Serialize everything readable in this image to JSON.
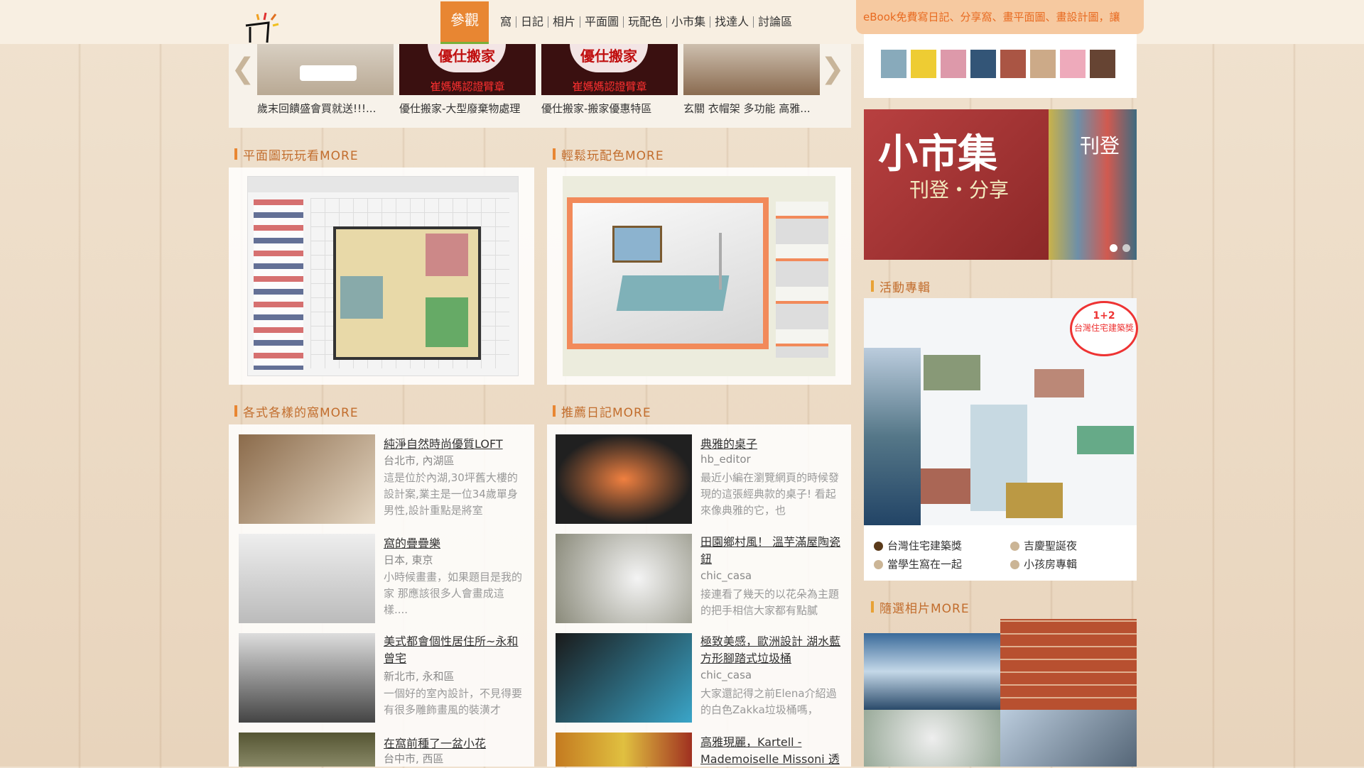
{
  "header": {
    "nav_active": "參觀",
    "nav_items": [
      "窩",
      "日記",
      "相片",
      "平面圖",
      "玩配色",
      "小市集",
      "找達人",
      "討論區"
    ],
    "announcement": "eBook免費寫日記、分享窩、畫平面圖、畫設計圖，讓"
  },
  "carousel": {
    "captions": [
      "歲末回饋盛會買就送!!!...",
      "優仕搬家-大型廢棄物處理",
      "優仕搬家-搬家優惠特區",
      "玄關 衣帽架 多功能 高雅..."
    ],
    "badge_text": "優仕搬家",
    "badge_sub": "崔媽媽認證臂章"
  },
  "sections": {
    "floorplan": "平面圖玩玩看MORE",
    "color": "輕鬆玩配色MORE",
    "homes": "各式各樣的窩MORE",
    "diary": "推薦日記MORE",
    "events": "活動專輯",
    "photos": "隨選相片MORE"
  },
  "homes": [
    {
      "title": "純淨自然時尚優質LOFT",
      "loc": "台北市, 內湖區",
      "desc": "這是位於內湖,30坪舊大樓的設計案,業主是一位34歲單身男性,設計重點是將室"
    },
    {
      "title": "窩的疊疊樂",
      "loc": "日本, 東京",
      "desc": "小時候畫畫，如果題目是我的家 那應該很多人會畫成這樣...."
    },
    {
      "title": "美式都會個性居住所~永和曾宅",
      "loc": "新北市, 永和區",
      "desc": "一個好的室內設計，不見得要有很多雕飾畫風的裝潢才"
    },
    {
      "title": "在窩前種了一盆小花",
      "loc": "台中市, 西區",
      "desc": ""
    }
  ],
  "diary": [
    {
      "title": "典雅的桌子",
      "author": "hb_editor",
      "desc": " 最近小編在瀏覽網頁的時候發現的這張經典款的桌子! 看起來像典雅的它，也"
    },
    {
      "title": "田園鄉村風！ 溫芋滿屋陶瓷鈕",
      "author": "chic_casa",
      "desc": "接連看了幾天的以花朵為主題的把手相信大家都有點膩"
    },
    {
      "title": "極致美感，歐洲設計 湖水藍方形腳踏式垃圾桶",
      "author": "chic_casa",
      "desc": "大家還記得之前Elena介紹過的白色Zakka垃圾桶嗎，"
    },
    {
      "title": "高雅現麗，Kartell - Mademoiselle Missoni 透",
      "author": "",
      "desc": ""
    }
  ],
  "market_banner": {
    "big": "小市集",
    "sub": "刊登・分享",
    "side": "刊登"
  },
  "events": {
    "bullets": [
      "台灣住宅建築獎",
      "吉慶聖誕夜",
      "當學生窩在一起",
      "小孩房專輯"
    ],
    "award_top": "1+2",
    "award_name": "台灣住宅建築獎"
  },
  "colors": {
    "accent": "#e88632",
    "green": "#7ab03a",
    "title": "#c26d2d"
  }
}
